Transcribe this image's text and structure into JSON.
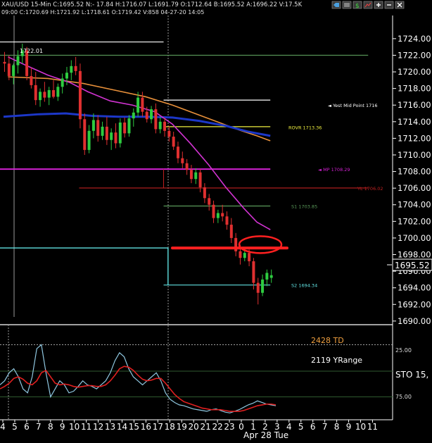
{
  "header": {
    "row1": "XAU/USD  15-Min  C:1695.52  N:- 17.84  H:1716.07  L:1691.79  O:1712.64  B:1695.52  A:1696.22  V:17.5K",
    "row2": "09:00  C:1720.69  H:1721.92  L:1718.61  O:1719.42  V:858  04-27-20  14:05"
  },
  "toolbar_icons": [
    "tag-icon",
    "grid-icon",
    "dollar-icon",
    "chart-icon",
    "plus-icon",
    "minus-icon",
    "close-icon"
  ],
  "colors": {
    "background": "#000000",
    "up_candle": "#2ecc40",
    "down_candle": "#e03030",
    "ma_orange": "#e8903a",
    "ma_blue": "#1c37c8",
    "ma_magenta": "#d233d2",
    "stoch_k": "#8fc7e0",
    "stoch_d": "#e02020",
    "td_text": "#f0a040",
    "level_white": "#ffffff",
    "level_magenta": "#d020d0",
    "level_red": "#c02020",
    "level_green": "#5a9a5a",
    "level_cyan": "#60e0e0",
    "level_yellow": "#f0f040",
    "annotation_red": "#ff2020"
  },
  "chart_data": {
    "type": "candlestick",
    "price_axis": {
      "ylim": [
        1688.8,
        1725.6
      ],
      "ticks": [
        1724.0,
        1722.0,
        1720.0,
        1718.0,
        1716.0,
        1714.0,
        1712.0,
        1710.0,
        1708.0,
        1706.0,
        1704.0,
        1702.0,
        1700.0,
        1698.0,
        1696.0,
        1694.0,
        1692.0,
        1690.0
      ],
      "current_price": "1695.52"
    },
    "time_axis": {
      "labels": [
        "4",
        "5",
        "6",
        "7",
        "8",
        "9",
        "10",
        "11",
        "12",
        "13",
        "14",
        "15",
        "16",
        "17",
        "18",
        "19",
        "20",
        "21",
        "22",
        "23",
        "0",
        "1",
        "2",
        "3",
        "4",
        "5",
        "6",
        "7",
        "8",
        "9",
        "10",
        "11"
      ],
      "date_label": "Apr 28 Tue"
    },
    "candles": [
      {
        "o": 1721.2,
        "h": 1722.4,
        "l": 1720.0,
        "c": 1721.0
      },
      {
        "o": 1721.0,
        "h": 1722.0,
        "l": 1719.0,
        "c": 1719.5
      },
      {
        "o": 1719.5,
        "h": 1721.0,
        "l": 1718.5,
        "c": 1720.8
      },
      {
        "o": 1720.8,
        "h": 1722.6,
        "l": 1719.8,
        "c": 1721.9
      },
      {
        "o": 1721.9,
        "h": 1723.4,
        "l": 1721.0,
        "c": 1722.6
      },
      {
        "o": 1722.6,
        "h": 1723.0,
        "l": 1719.0,
        "c": 1719.5
      },
      {
        "o": 1719.5,
        "h": 1720.5,
        "l": 1718.0,
        "c": 1718.4
      },
      {
        "o": 1718.4,
        "h": 1720.0,
        "l": 1716.0,
        "c": 1716.6
      },
      {
        "o": 1716.6,
        "h": 1718.0,
        "l": 1715.8,
        "c": 1717.6
      },
      {
        "o": 1717.6,
        "h": 1718.8,
        "l": 1716.4,
        "c": 1716.9
      },
      {
        "o": 1716.9,
        "h": 1718.2,
        "l": 1716.0,
        "c": 1717.8
      },
      {
        "o": 1717.8,
        "h": 1719.0,
        "l": 1716.8,
        "c": 1717.0
      },
      {
        "o": 1717.0,
        "h": 1718.6,
        "l": 1716.5,
        "c": 1718.2
      },
      {
        "o": 1718.2,
        "h": 1719.8,
        "l": 1717.4,
        "c": 1719.2
      },
      {
        "o": 1719.2,
        "h": 1720.6,
        "l": 1718.4,
        "c": 1719.9
      },
      {
        "o": 1719.9,
        "h": 1721.4,
        "l": 1719.0,
        "c": 1720.7
      },
      {
        "o": 1720.7,
        "h": 1721.8,
        "l": 1719.6,
        "c": 1720.1
      },
      {
        "o": 1720.1,
        "h": 1721.0,
        "l": 1713.2,
        "c": 1714.3
      },
      {
        "o": 1714.3,
        "h": 1715.0,
        "l": 1710.0,
        "c": 1710.6
      },
      {
        "o": 1710.6,
        "h": 1713.6,
        "l": 1710.2,
        "c": 1712.9
      },
      {
        "o": 1712.9,
        "h": 1715.0,
        "l": 1712.0,
        "c": 1714.2
      },
      {
        "o": 1714.2,
        "h": 1714.8,
        "l": 1711.6,
        "c": 1712.3
      },
      {
        "o": 1712.3,
        "h": 1714.0,
        "l": 1711.8,
        "c": 1713.4
      },
      {
        "o": 1713.4,
        "h": 1714.6,
        "l": 1711.2,
        "c": 1711.8
      },
      {
        "o": 1711.8,
        "h": 1713.2,
        "l": 1710.6,
        "c": 1712.7
      },
      {
        "o": 1712.7,
        "h": 1713.8,
        "l": 1710.8,
        "c": 1711.4
      },
      {
        "o": 1711.4,
        "h": 1714.4,
        "l": 1710.9,
        "c": 1713.9
      },
      {
        "o": 1713.9,
        "h": 1714.5,
        "l": 1712.1,
        "c": 1712.6
      },
      {
        "o": 1712.6,
        "h": 1714.8,
        "l": 1712.2,
        "c": 1714.4
      },
      {
        "o": 1714.4,
        "h": 1715.6,
        "l": 1713.4,
        "c": 1715.1
      },
      {
        "o": 1715.1,
        "h": 1717.6,
        "l": 1714.6,
        "c": 1716.9
      },
      {
        "o": 1716.9,
        "h": 1717.6,
        "l": 1714.6,
        "c": 1715.2
      },
      {
        "o": 1715.2,
        "h": 1715.8,
        "l": 1713.9,
        "c": 1714.3
      },
      {
        "o": 1714.3,
        "h": 1715.9,
        "l": 1713.8,
        "c": 1715.5
      },
      {
        "o": 1715.5,
        "h": 1716.2,
        "l": 1712.6,
        "c": 1713.1
      },
      {
        "o": 1713.1,
        "h": 1714.6,
        "l": 1712.6,
        "c": 1714.0
      },
      {
        "o": 1714.0,
        "h": 1714.5,
        "l": 1712.2,
        "c": 1712.9
      },
      {
        "o": 1712.9,
        "h": 1713.5,
        "l": 1711.6,
        "c": 1712.2
      },
      {
        "o": 1712.2,
        "h": 1712.8,
        "l": 1710.6,
        "c": 1711.0
      },
      {
        "o": 1711.0,
        "h": 1711.6,
        "l": 1709.0,
        "c": 1709.6
      },
      {
        "o": 1709.6,
        "h": 1710.4,
        "l": 1708.4,
        "c": 1709.0
      },
      {
        "o": 1709.0,
        "h": 1709.5,
        "l": 1707.6,
        "c": 1708.2
      },
      {
        "o": 1708.2,
        "h": 1708.8,
        "l": 1706.6,
        "c": 1707.1
      },
      {
        "o": 1707.1,
        "h": 1708.4,
        "l": 1706.5,
        "c": 1707.9
      },
      {
        "o": 1707.9,
        "h": 1708.3,
        "l": 1705.5,
        "c": 1706.1
      },
      {
        "o": 1706.1,
        "h": 1706.6,
        "l": 1704.2,
        "c": 1704.8
      },
      {
        "o": 1704.8,
        "h": 1705.3,
        "l": 1703.3,
        "c": 1704.0
      },
      {
        "o": 1704.0,
        "h": 1704.5,
        "l": 1701.8,
        "c": 1702.4
      },
      {
        "o": 1702.4,
        "h": 1703.4,
        "l": 1701.8,
        "c": 1703.0
      },
      {
        "o": 1703.0,
        "h": 1704.0,
        "l": 1702.0,
        "c": 1702.6
      },
      {
        "o": 1702.6,
        "h": 1703.2,
        "l": 1701.0,
        "c": 1701.6
      },
      {
        "o": 1701.6,
        "h": 1702.4,
        "l": 1699.4,
        "c": 1700.0
      },
      {
        "o": 1700.0,
        "h": 1700.6,
        "l": 1697.8,
        "c": 1698.4
      },
      {
        "o": 1698.4,
        "h": 1699.2,
        "l": 1696.8,
        "c": 1697.6
      },
      {
        "o": 1697.6,
        "h": 1698.8,
        "l": 1697.2,
        "c": 1698.2
      },
      {
        "o": 1698.2,
        "h": 1698.6,
        "l": 1696.6,
        "c": 1697.2
      },
      {
        "o": 1697.2,
        "h": 1697.6,
        "l": 1693.8,
        "c": 1694.6
      },
      {
        "o": 1694.6,
        "h": 1695.2,
        "l": 1692.0,
        "c": 1693.4
      },
      {
        "o": 1693.4,
        "h": 1695.6,
        "l": 1693.0,
        "c": 1695.0
      },
      {
        "o": 1695.0,
        "h": 1696.2,
        "l": 1694.2,
        "c": 1695.8
      },
      {
        "o": 1695.2,
        "h": 1696.2,
        "l": 1694.6,
        "c": 1695.52
      }
    ],
    "moving_averages": [
      {
        "color_key": "ma_orange",
        "points": [
          [
            1,
            1719.4
          ],
          [
            10,
            1719.2
          ],
          [
            18,
            1718.6
          ],
          [
            25,
            1717.8
          ],
          [
            32,
            1717.0
          ],
          [
            38,
            1716.0
          ],
          [
            44,
            1714.8
          ],
          [
            49,
            1713.8
          ],
          [
            53,
            1713.0
          ],
          [
            57,
            1712.3
          ],
          [
            60,
            1711.7
          ]
        ]
      },
      {
        "color_key": "ma_blue",
        "points": [
          [
            0,
            1714.6
          ],
          [
            8,
            1714.9
          ],
          [
            14,
            1715.0
          ],
          [
            20,
            1714.7
          ],
          [
            26,
            1714.6
          ],
          [
            32,
            1714.6
          ],
          [
            38,
            1714.5
          ],
          [
            44,
            1714.1
          ],
          [
            50,
            1713.5
          ],
          [
            55,
            1712.8
          ],
          [
            60,
            1712.3
          ]
        ]
      },
      {
        "color_key": "ma_magenta",
        "points": [
          [
            1,
            1721.8
          ],
          [
            5,
            1720.8
          ],
          [
            10,
            1719.6
          ],
          [
            15,
            1718.7
          ],
          [
            19,
            1717.6
          ],
          [
            24,
            1716.5
          ],
          [
            29,
            1716.0
          ],
          [
            34,
            1715.2
          ],
          [
            38,
            1713.7
          ],
          [
            42,
            1711.4
          ],
          [
            46,
            1708.9
          ],
          [
            50,
            1706.1
          ],
          [
            54,
            1703.6
          ],
          [
            57,
            1701.9
          ],
          [
            60,
            1701.0
          ]
        ]
      }
    ],
    "levels": [
      {
        "price": 1723.6,
        "label": "",
        "color_key": "level_white",
        "x_start": -1,
        "x_end": 36
      },
      {
        "price": 1722.0,
        "label": "",
        "color_key": "level_green",
        "x_start": -1,
        "x_end": 82
      },
      {
        "price": 1716.6,
        "label": "",
        "color_key": "level_white",
        "x_start": 36,
        "x_end": 60
      },
      {
        "price": 1713.4,
        "label": "",
        "color_key": "level_yellow",
        "x_start": 36,
        "x_end": 60
      },
      {
        "price": 1708.29,
        "label": "",
        "color_key": "level_magenta",
        "x_start": -1,
        "x_end": 60
      },
      {
        "price": 1706.02,
        "label": "",
        "color_key": "level_red",
        "x_start": 17,
        "x_end": 82
      },
      {
        "price": 1703.85,
        "label": "",
        "color_key": "level_green",
        "x_start": 36,
        "x_end": 60
      },
      {
        "price": 1694.34,
        "label": "",
        "color_key": "level_cyan",
        "x_start": 36,
        "x_end": 60
      }
    ],
    "level_labels": [
      {
        "price": 1716.0,
        "text": "◄ Yest Mid Point 1716",
        "color_key": "level_white"
      },
      {
        "price": 1713.36,
        "text": "ROVR 1713.36",
        "color_key": "level_yellow"
      },
      {
        "price": 1708.29,
        "text": "◄ MP 1708.29",
        "color_key": "level_magenta"
      },
      {
        "price": 1706.02,
        "text": "YL 1706.02",
        "color_key": "level_red"
      },
      {
        "price": 1703.85,
        "text": "S1 1703.85",
        "color_key": "level_green"
      },
      {
        "price": 1694.34,
        "text": "S2 1694.34",
        "color_key": "level_cyan"
      }
    ],
    "value_label": {
      "price": 1722.0,
      "text": "1722.01"
    },
    "annotations": {
      "horizontal_line_price": 1698.8,
      "circle_center_price": 1699.2
    },
    "oscillator": {
      "name": "STO 15,",
      "ticks": [
        "25.00",
        "75.00"
      ],
      "td_label": "2428 TD",
      "yrange_label": "2119 YRange",
      "k_values": [
        40,
        45,
        55,
        60,
        50,
        35,
        30,
        50,
        85,
        90,
        55,
        25,
        35,
        45,
        40,
        30,
        32,
        38,
        45,
        40,
        38,
        35,
        40,
        45,
        55,
        70,
        80,
        75,
        60,
        50,
        45,
        40,
        45,
        50,
        55,
        45,
        30,
        22,
        18,
        15,
        14,
        12,
        10,
        9,
        8,
        7,
        9,
        10,
        8,
        6,
        5,
        7,
        9,
        12,
        15,
        17,
        20,
        18,
        16,
        15,
        14
      ],
      "d_values": [
        35,
        38,
        42,
        48,
        50,
        47,
        42,
        40,
        45,
        55,
        58,
        50,
        42,
        40,
        41,
        40,
        38,
        37,
        38,
        39,
        39,
        38,
        38,
        40,
        45,
        52,
        60,
        63,
        62,
        58,
        52,
        47,
        45,
        46,
        48,
        48,
        42,
        35,
        28,
        23,
        19,
        17,
        15,
        13,
        11,
        10,
        9,
        9,
        9,
        8,
        7,
        7,
        7,
        8,
        10,
        12,
        14,
        15,
        16,
        16,
        15
      ]
    }
  }
}
